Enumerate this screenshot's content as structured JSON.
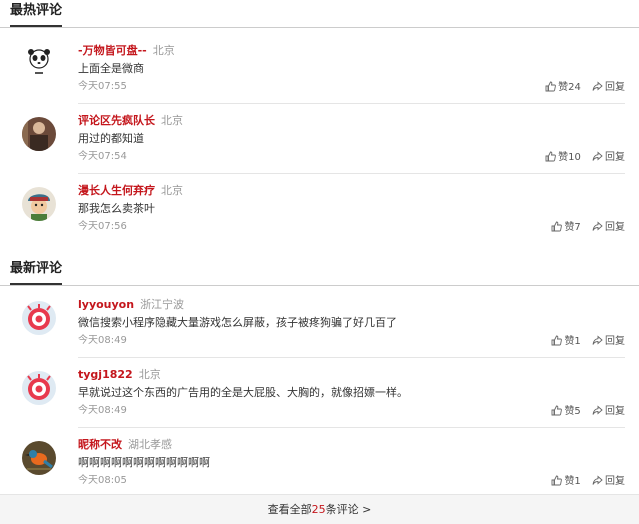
{
  "hot": {
    "title": "最热评论",
    "comments": [
      {
        "name": "-万物皆可盘--",
        "location": "北京",
        "text": "上面全是微商",
        "time": "今天07:55",
        "likes": "赞24",
        "reply": "回复"
      },
      {
        "name": "评论区先疯队长",
        "location": "北京",
        "text": "用过的都知道",
        "time": "今天07:54",
        "likes": "赞10",
        "reply": "回复"
      },
      {
        "name": "漫长人生何弃疗",
        "location": "北京",
        "text": "那我怎么卖茶叶",
        "time": "今天07:56",
        "likes": "赞7",
        "reply": "回复"
      }
    ]
  },
  "latest": {
    "title": "最新评论",
    "comments": [
      {
        "name": "lyyouyon",
        "location": "浙江宁波",
        "text": "微信搜索小程序隐藏大量游戏怎么屏蔽，孩子被疼狗骗了好几百了",
        "time": "今天08:49",
        "likes": "赞1",
        "reply": "回复"
      },
      {
        "name": "tygj1822",
        "location": "北京",
        "text": "早就说过这个东西的广告用的全是大屁股、大胸的，就像招嫖一样。",
        "time": "今天08:49",
        "likes": "赞5",
        "reply": "回复"
      },
      {
        "name": "昵称不改",
        "location": "湖北孝感",
        "text": "啊啊啊啊啊啊啊啊啊啊啊啊",
        "time": "今天08:05",
        "likes": "赞1",
        "reply": "回复"
      }
    ]
  },
  "footer": {
    "prefix": "查看全部",
    "count": "25",
    "suffix": "条评论 >"
  },
  "colors": {
    "username": "#c4161c",
    "meta": "#999999",
    "accent_count": "#c4161c"
  }
}
